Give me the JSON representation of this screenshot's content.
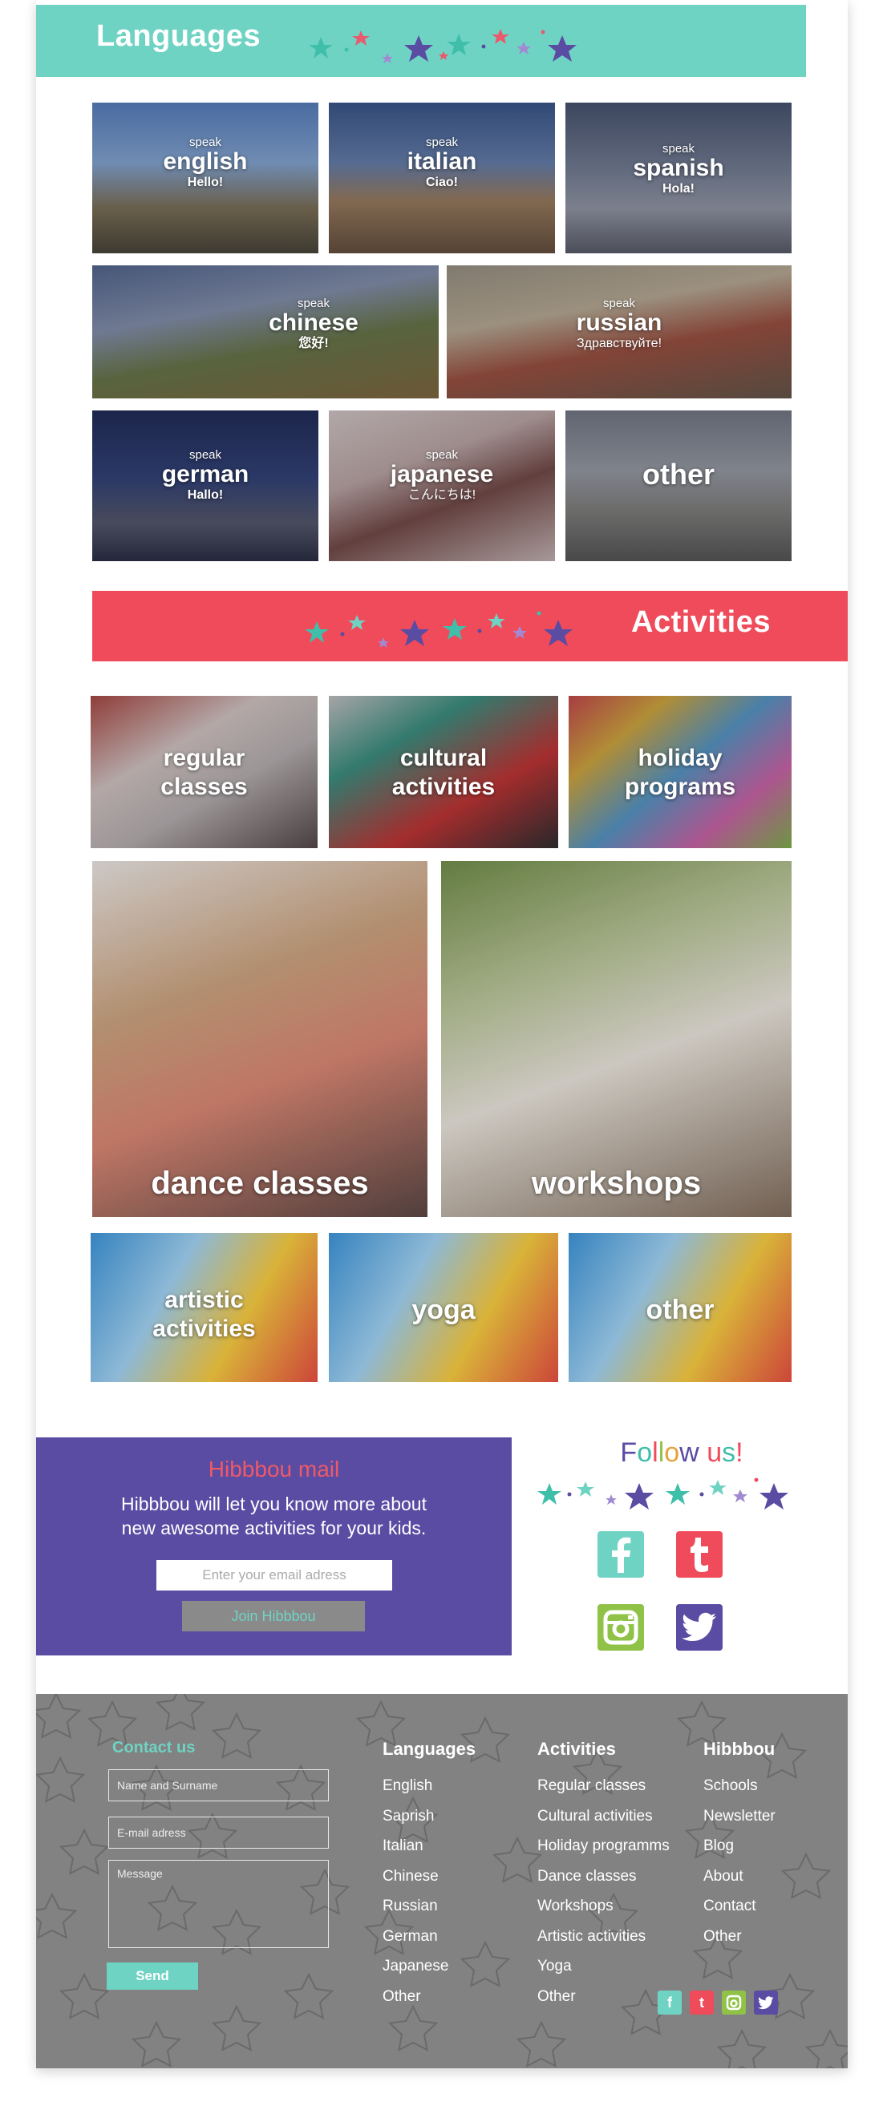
{
  "colors": {
    "teal": "#6fd3c4",
    "coral": "#ef4b5a",
    "purple": "#5a4ba3",
    "gray": "#828282"
  },
  "languages": {
    "title": "Languages",
    "tiles": [
      {
        "speak": "speak",
        "name": "english",
        "greeting": "Hello!"
      },
      {
        "speak": "speak",
        "name": "italian",
        "greeting": "Ciao!"
      },
      {
        "speak": "speak",
        "name": "spanish",
        "greeting": "Hola!"
      },
      {
        "speak": "speak",
        "name": "chinese",
        "greeting": "您好!"
      },
      {
        "speak": "speak",
        "name": "russian",
        "greeting": "Здравствуйте!"
      },
      {
        "speak": "speak",
        "name": "german",
        "greeting": "Hallo!"
      },
      {
        "speak": "speak",
        "name": "japanese",
        "greeting": "こんにちは!"
      },
      {
        "speak": "",
        "name": "other",
        "greeting": ""
      }
    ]
  },
  "activities": {
    "title": "Activities",
    "tiles": [
      {
        "line1": "regular",
        "line2": "classes"
      },
      {
        "line1": "cultural",
        "line2": "activities"
      },
      {
        "line1": "holiday",
        "line2": "programs"
      },
      {
        "line1": "dance classes",
        "line2": ""
      },
      {
        "line1": "workshops",
        "line2": ""
      },
      {
        "line1": "artistic",
        "line2": "activities"
      },
      {
        "line1": "yoga",
        "line2": ""
      },
      {
        "line1": "other",
        "line2": ""
      }
    ]
  },
  "mail": {
    "title": "Hibbbou mail",
    "desc_line1": "Hibbbou will let you know more about",
    "desc_line2": "new awesome activities for your kids.",
    "placeholder": "Enter your email adress",
    "button": "Join Hibbbou"
  },
  "follow": {
    "title_letters": [
      "F",
      "o",
      "l",
      "l",
      "o",
      "w",
      " ",
      "u",
      "s",
      "!"
    ],
    "icons": [
      "facebook-icon",
      "tumblr-icon",
      "instagram-icon",
      "twitter-icon"
    ]
  },
  "footer": {
    "contact_title": "Contact us",
    "name_placeholder": "Name and Surname",
    "email_placeholder": "E-mail adress",
    "message_placeholder": "Message",
    "send": "Send",
    "columns": [
      {
        "title": "Languages",
        "items": [
          "English",
          "Saprish",
          "Italian",
          "Chinese",
          "Russian",
          "German",
          "Japanese",
          "Other"
        ]
      },
      {
        "title": "Activities",
        "items": [
          "Regular classes",
          "Cultural activities",
          "Holiday programms",
          "Dance classes",
          "Workshops",
          "Artistic activities",
          "Yoga",
          "Other"
        ]
      },
      {
        "title": "Hibbbou",
        "items": [
          "Schools",
          "Newsletter",
          "Blog",
          "About",
          "Contact",
          "Other"
        ]
      }
    ]
  }
}
